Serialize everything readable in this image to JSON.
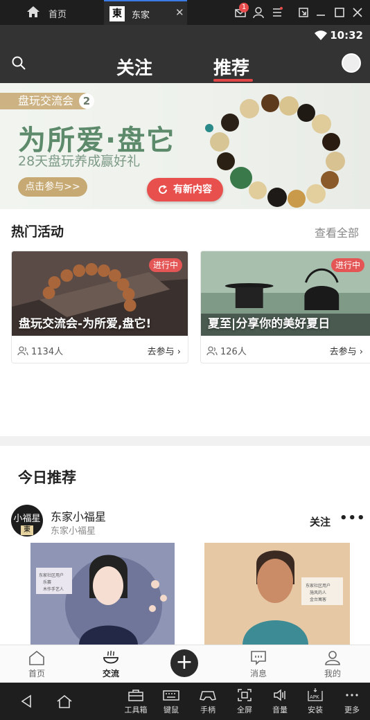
{
  "emulator": {
    "home_label": "首页",
    "tab_label": "东家",
    "tab_logo": "東",
    "tab_close": "✕",
    "notification_count": "1",
    "toolbar": [
      {
        "label": "工具箱",
        "icon": "toolbox-icon"
      },
      {
        "label": "键鼠",
        "icon": "keyboard-icon"
      },
      {
        "label": "手柄",
        "icon": "gamepad-icon"
      },
      {
        "label": "全屏",
        "icon": "fullscreen-icon"
      },
      {
        "label": "音量",
        "icon": "volume-icon"
      },
      {
        "label": "安装",
        "icon": "apk-install-icon"
      },
      {
        "label": "更多",
        "icon": "more-icon"
      }
    ]
  },
  "status_bar": {
    "time": "10:32"
  },
  "header": {
    "tabs": [
      "关注",
      "推荐"
    ],
    "active_tab": "推荐"
  },
  "banner": {
    "tag": "盘玩交流会",
    "tag_number": "2",
    "title": "为所爱·盘它",
    "subtitle": "28天盘玩养成赢好礼",
    "button": "点击参与>>",
    "new_content": "有新内容"
  },
  "hot_activities": {
    "title": "热门活动",
    "see_all": "查看全部",
    "cards": [
      {
        "status": "进行中",
        "title": "盘玩交流会-为所爱,盘它!",
        "participants": "1134人",
        "join": "去参与 ›"
      },
      {
        "status": "进行中",
        "title": "夏至|分享你的美好夏日",
        "participants": "126人",
        "join": "去参与 ›"
      }
    ]
  },
  "today": {
    "title": "今日推荐",
    "user": {
      "name": "东家小福星",
      "subtitle": "东家小福星",
      "avatar_text": "小福星",
      "avatar_logo": "東"
    },
    "follow": "关注",
    "more": "•••",
    "post1_lines": [
      "东家社区用户",
      "乐赛",
      "木作手艺人"
    ],
    "post2_lines": [
      "东家社区用户",
      "施风的人",
      "金台寓客"
    ]
  },
  "bottom_nav": [
    {
      "label": "首页",
      "icon": "home-icon"
    },
    {
      "label": "交流",
      "icon": "community-icon"
    },
    {
      "label": "",
      "icon": "plus-icon"
    },
    {
      "label": "消息",
      "icon": "message-icon"
    },
    {
      "label": "我的",
      "icon": "profile-icon"
    }
  ],
  "colors": {
    "accent": "#e04646",
    "banner_green": "#5c8a6a",
    "gold": "#c7a973"
  }
}
